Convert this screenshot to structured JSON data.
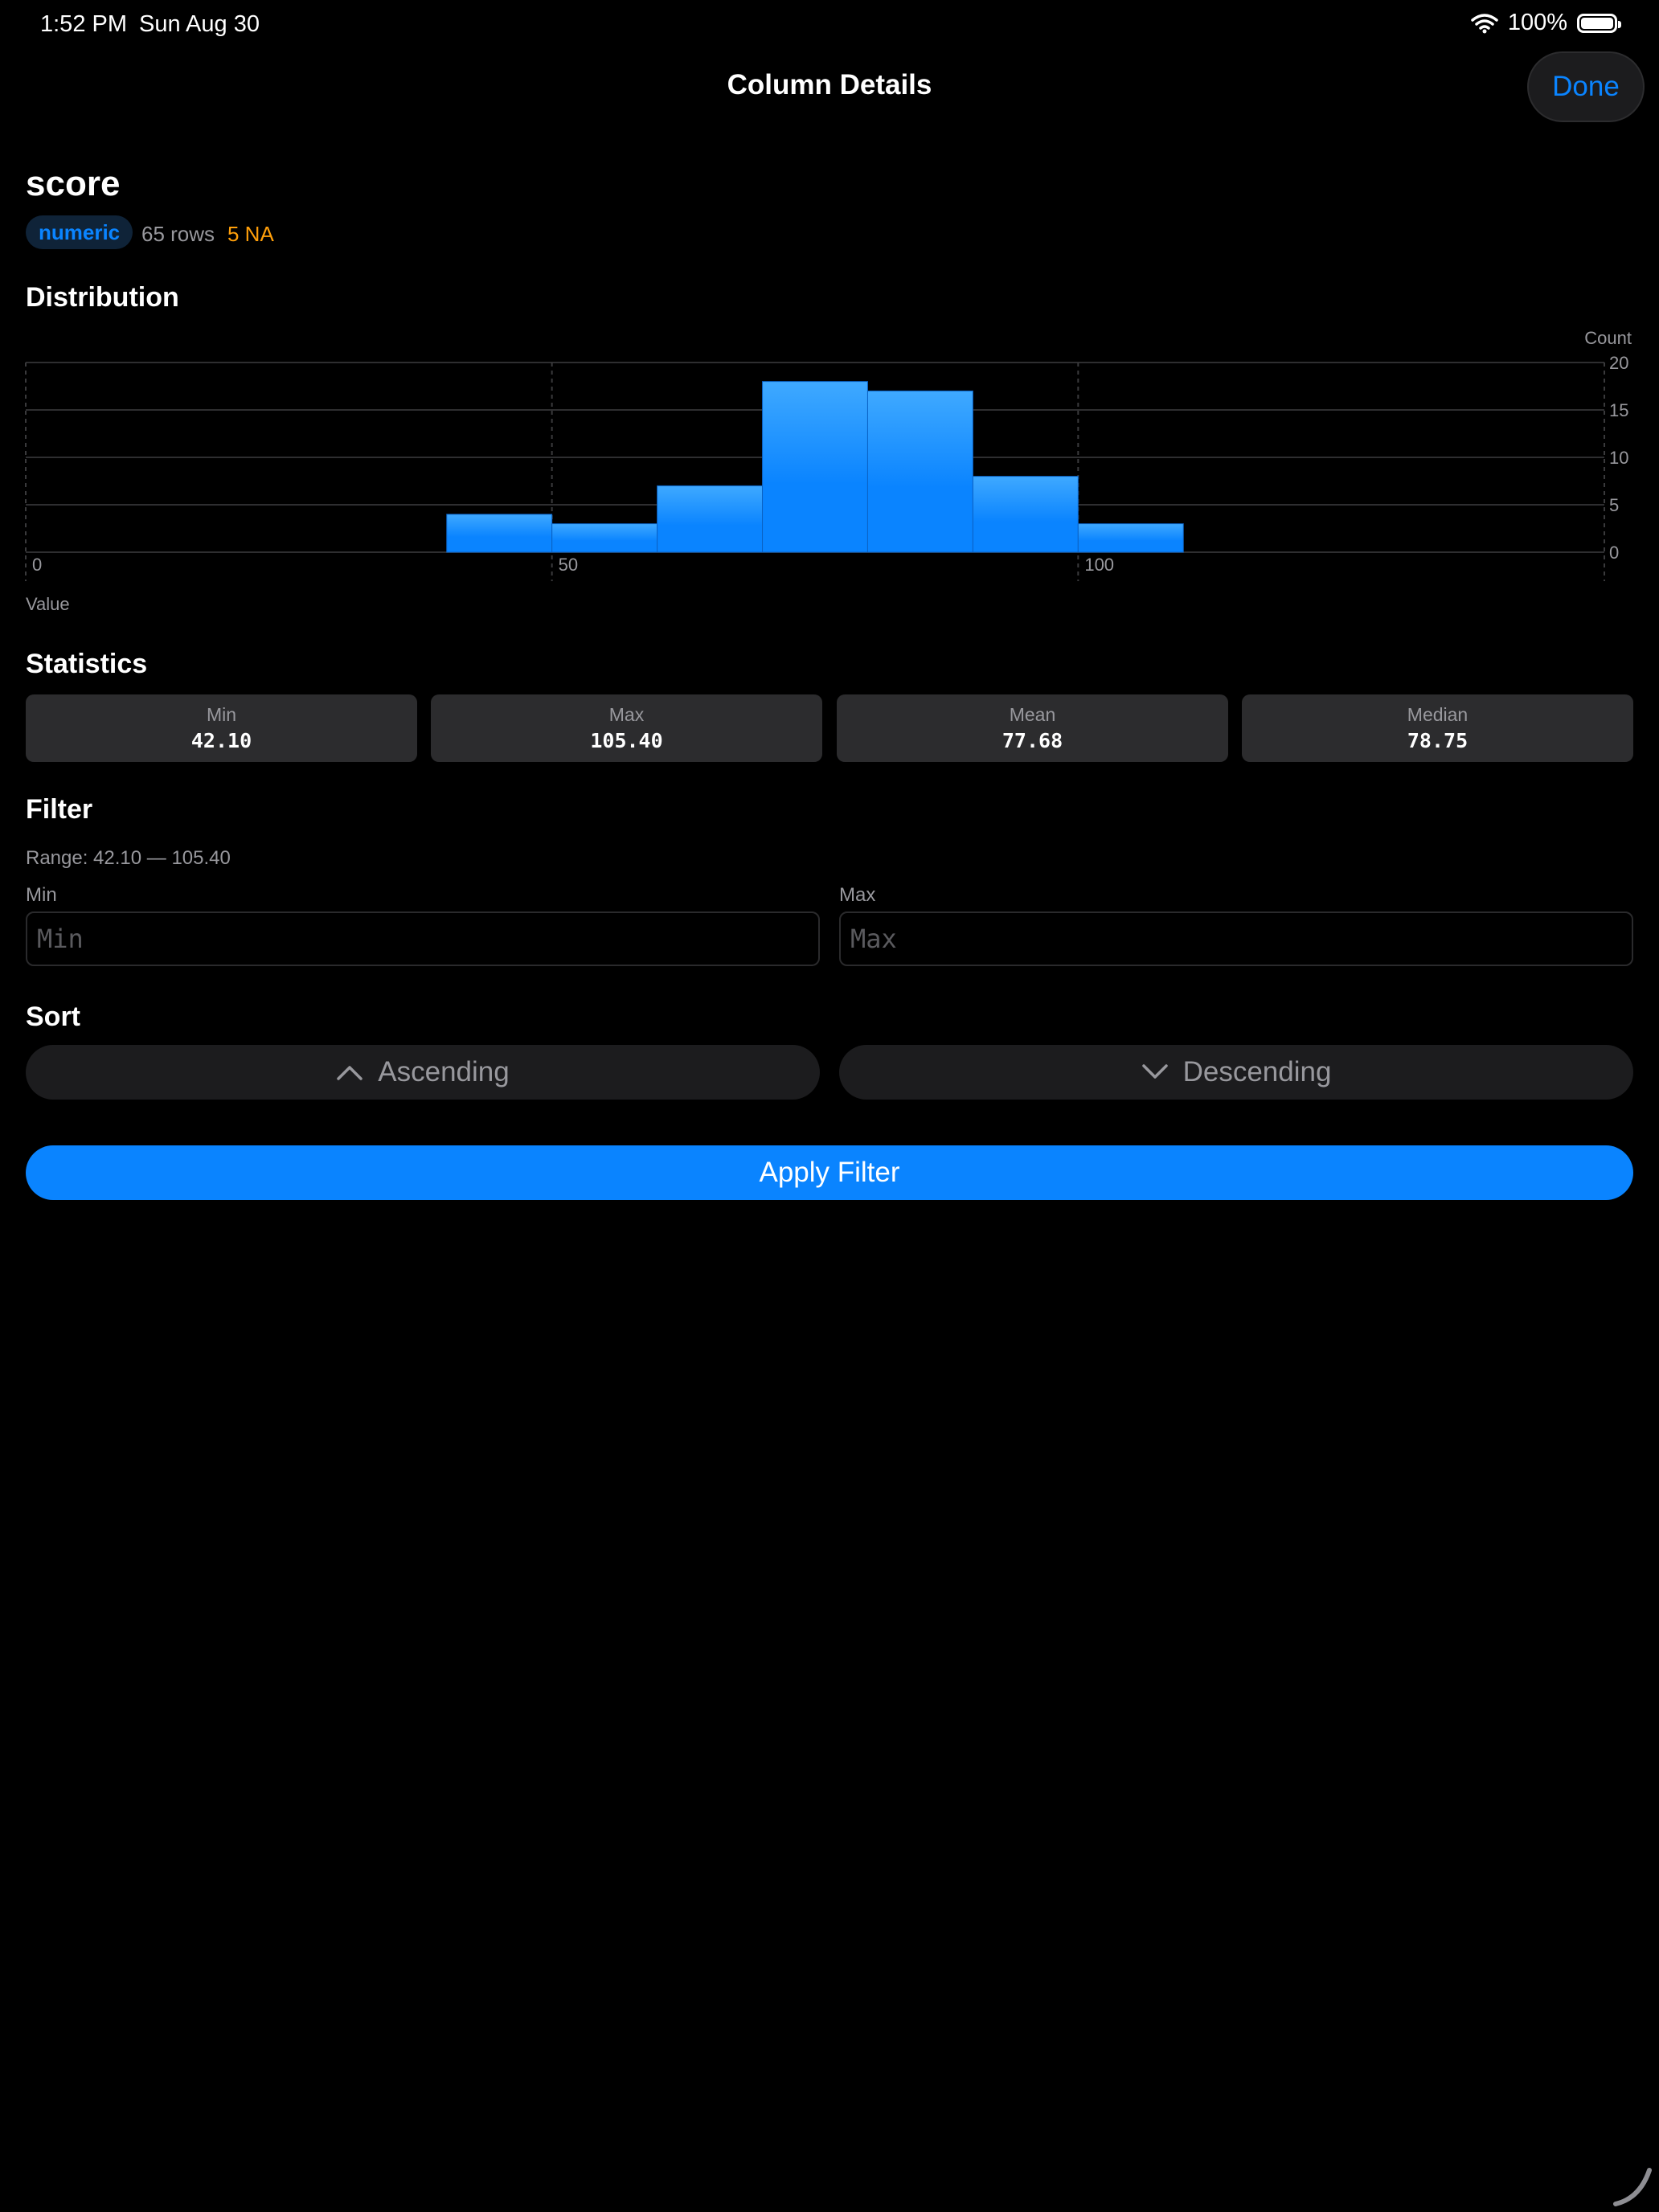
{
  "status_bar": {
    "time": "1:52 PM",
    "date": "Sun Aug 30",
    "battery": "100%"
  },
  "nav": {
    "title": "Column Details",
    "done_label": "Done"
  },
  "column": {
    "name": "score",
    "type": "numeric",
    "rows": "65 rows",
    "na": "5 NA"
  },
  "sections": {
    "distribution": "Distribution",
    "statistics": "Statistics",
    "filter": "Filter",
    "sort": "Sort"
  },
  "chart_data": {
    "type": "bar",
    "xlabel": "Value",
    "ylabel": "Count",
    "xlim": [
      0,
      150
    ],
    "ylim": [
      0,
      20
    ],
    "xticks": [
      0,
      50,
      100
    ],
    "yticks": [
      0,
      5,
      10,
      15,
      20
    ],
    "bins": [
      {
        "start": 40,
        "end": 50,
        "count": 4
      },
      {
        "start": 50,
        "end": 60,
        "count": 3
      },
      {
        "start": 60,
        "end": 70,
        "count": 7
      },
      {
        "start": 70,
        "end": 80,
        "count": 18
      },
      {
        "start": 80,
        "end": 90,
        "count": 17
      },
      {
        "start": 90,
        "end": 100,
        "count": 8
      },
      {
        "start": 100,
        "end": 110,
        "count": 3
      }
    ],
    "grid": true,
    "bar_color": "#0a84ff"
  },
  "statistics": [
    {
      "label": "Min",
      "value": "42.10"
    },
    {
      "label": "Max",
      "value": "105.40"
    },
    {
      "label": "Mean",
      "value": "77.68"
    },
    {
      "label": "Median",
      "value": "78.75"
    }
  ],
  "filter": {
    "range_text": "Range: 42.10 — 105.40",
    "min_label": "Min",
    "max_label": "Max",
    "min_placeholder": "Min",
    "max_placeholder": "Max",
    "min_value": "",
    "max_value": ""
  },
  "sort": {
    "ascending_label": "Ascending",
    "descending_label": "Descending"
  },
  "apply_label": "Apply Filter",
  "colors": {
    "accent": "#0a84ff",
    "warning": "#ff9f0a",
    "card": "#2c2c2e",
    "background": "#000000"
  }
}
